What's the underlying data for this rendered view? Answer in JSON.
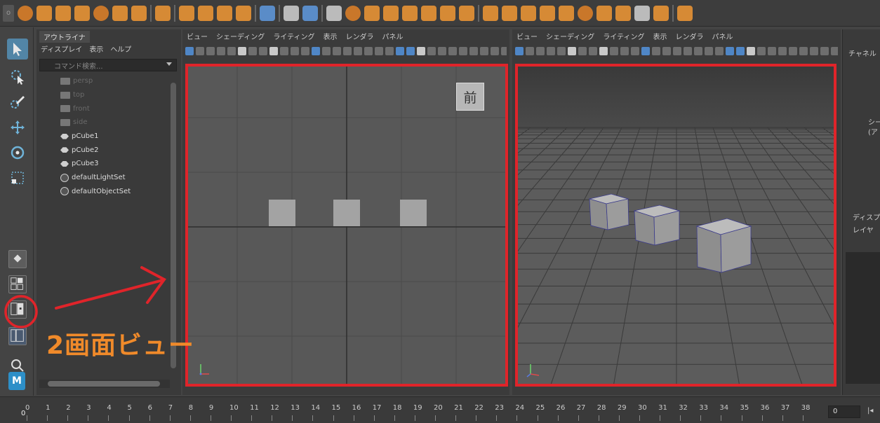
{
  "outliner": {
    "title": "アウトライナ",
    "menu": [
      "ディスプレイ",
      "表示",
      "ヘルプ"
    ],
    "search_placeholder": "コマンド検索...",
    "items": [
      {
        "label": "persp",
        "type": "camera",
        "dim": true
      },
      {
        "label": "top",
        "type": "camera",
        "dim": true
      },
      {
        "label": "front",
        "type": "camera",
        "dim": true
      },
      {
        "label": "side",
        "type": "camera",
        "dim": true
      },
      {
        "label": "pCube1",
        "type": "transform",
        "dim": false
      },
      {
        "label": "pCube2",
        "type": "transform",
        "dim": false
      },
      {
        "label": "pCube3",
        "type": "transform",
        "dim": false
      },
      {
        "label": "defaultLightSet",
        "type": "set",
        "dim": false
      },
      {
        "label": "defaultObjectSet",
        "type": "set",
        "dim": false
      }
    ]
  },
  "panel_left": {
    "menu": [
      "ビュー",
      "シェーディング",
      "ライティング",
      "表示",
      "レンダラ",
      "パネル"
    ],
    "view_label": "前"
  },
  "panel_right": {
    "menu": [
      "ビュー",
      "シェーディング",
      "ライティング",
      "表示",
      "レンダラ",
      "パネル"
    ]
  },
  "channel_box": {
    "title": "チャネル",
    "line1": "シー",
    "line2": "(ア",
    "display_tab": "ディスプレ",
    "layer_label": "レイヤ"
  },
  "annotation": {
    "text": "2画面ビュー",
    "color": "#f08a2a",
    "highlight_color": "#e0242a"
  },
  "timeline": {
    "frames": [
      "0",
      "1",
      "2",
      "3",
      "4",
      "5",
      "6",
      "7",
      "8",
      "9",
      "10",
      "11",
      "12",
      "13",
      "14",
      "15",
      "16",
      "17",
      "18",
      "19",
      "20",
      "21",
      "22",
      "23",
      "24",
      "25",
      "26",
      "27",
      "28",
      "29",
      "30",
      "31",
      "32",
      "33",
      "34",
      "35",
      "36",
      "37",
      "38"
    ],
    "current_frame": "0",
    "field_value": "0"
  },
  "icons": {
    "select": "select-arrow-icon",
    "lasso": "lasso-select-icon",
    "paint": "paint-select-icon",
    "move": "move-tool-icon",
    "rotate": "rotate-tool-icon",
    "scale": "scale-tool-icon",
    "search": "search-icon",
    "maya": "maya-logo"
  },
  "maya_logo_text": "M"
}
